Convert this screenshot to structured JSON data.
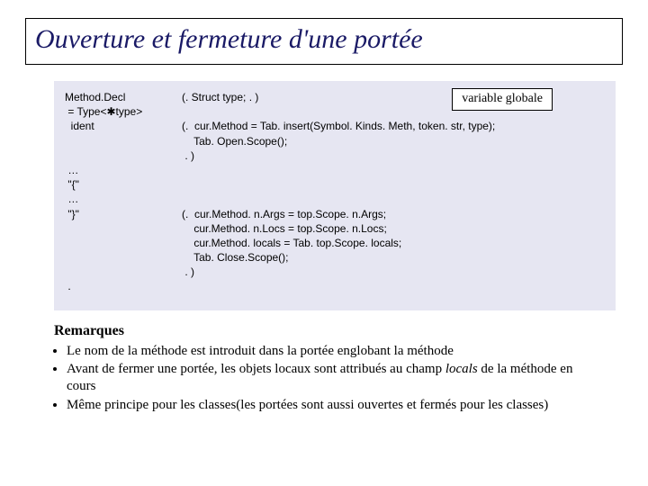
{
  "title": "Ouverture et fermeture d'une portée",
  "callout": "variable globale",
  "code": {
    "l1_left": "Method.Decl",
    "l1_right": "(. Struct type; . )",
    "l2_left": " = Type<✱type>",
    "l2_right": "",
    "l3_left": "  ident",
    "l3_right": "(.  cur.Method = Tab. insert(Symbol. Kinds. Meth, token. str, type);",
    "l4_left": "",
    "l4_right": "    Tab. Open.Scope();",
    "l5_left": "",
    "l5_right": " . )",
    "l6_left": " …",
    "l6_right": "",
    "l7_left": " \"{\"",
    "l7_right": "",
    "l8_left": " …",
    "l8_right": "",
    "l9_left": " \"}\"",
    "l9_right": "(.  cur.Method. n.Args = top.Scope. n.Args;",
    "l10_left": "",
    "l10_right": "    cur.Method. n.Locs = top.Scope. n.Locs;",
    "l11_left": "",
    "l11_right": "    cur.Method. locals = Tab. top.Scope. locals;",
    "l12_left": "",
    "l12_right": "    Tab. Close.Scope();",
    "l13_left": "",
    "l13_right": " . )",
    "l14_left": " .",
    "l14_right": ""
  },
  "remarks": {
    "heading": "Remarques",
    "b1": "Le nom de la méthode est introduit dans la portée englobant la méthode",
    "b2_a": "Avant de fermer une portée, les objets locaux sont attribués au champ ",
    "b2_i": "locals",
    "b2_b": " de la méthode en cours",
    "b3": "Même principe pour les classes(les portées sont aussi ouvertes et fermés pour les classes)"
  }
}
